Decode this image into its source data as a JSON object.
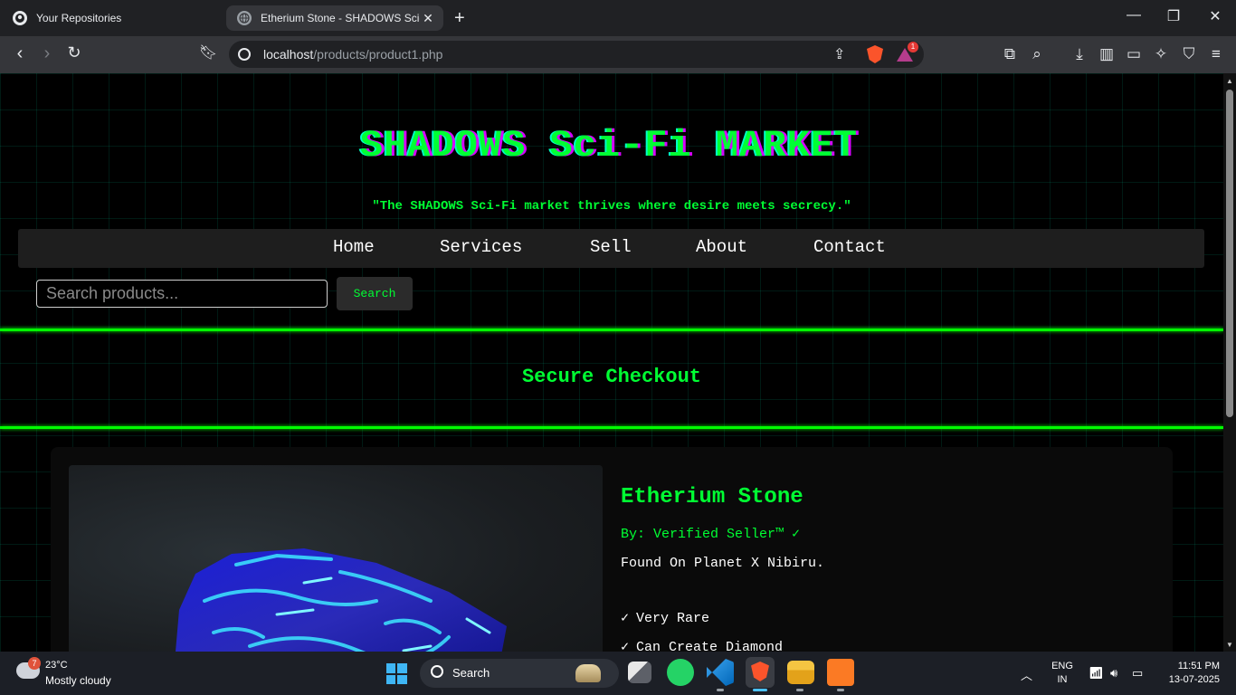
{
  "browser": {
    "tabs": [
      {
        "title": "Your Repositories",
        "active": false,
        "favicon": "github-icon"
      },
      {
        "title": "Etherium Stone - SHADOWS Sci-Fi MARKET",
        "active": true,
        "favicon": "globe-icon"
      }
    ],
    "url_host": "localhost",
    "url_path": "/products/product1.php",
    "brave_badge_count": "1"
  },
  "site": {
    "title": "SHADOWS Sci-Fi MARKET",
    "tagline": "\"The SHADOWS Sci-Fi market thrives where desire meets secrecy.\"",
    "nav": [
      "Home",
      "Services",
      "Sell",
      "About",
      "Contact"
    ],
    "search_placeholder": "Search products...",
    "search_button": "Search",
    "section_title": "Secure Checkout"
  },
  "product": {
    "name": "Etherium Stone",
    "seller": "By: Verified Seller™ ✓",
    "origin": "Found On Planet X Nibiru.",
    "features": [
      "Very Rare",
      "Can Create Diamond"
    ],
    "feature_tick": "✓"
  },
  "taskbar": {
    "weather_temp": "23°C",
    "weather_desc": "Mostly cloudy",
    "weather_badge": "7",
    "search_label": "Search",
    "lang_line1": "ENG",
    "lang_line2": "IN",
    "time": "11:51 PM",
    "date": "13-07-2025"
  },
  "colors": {
    "accent_green": "#00ff33",
    "title_shadow_magenta": "#d600ff",
    "page_background": "#000000",
    "nav_background": "#1e1e1e"
  }
}
